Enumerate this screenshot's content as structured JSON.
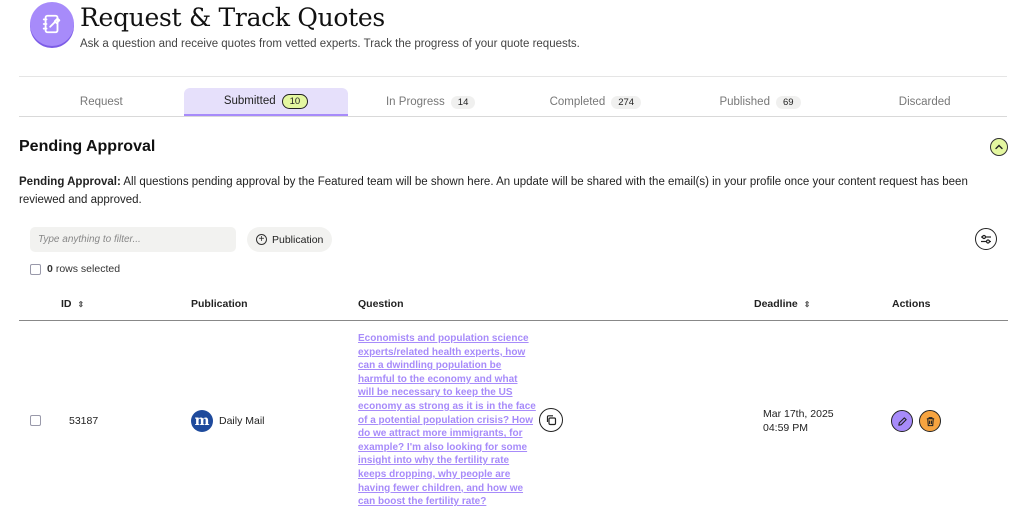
{
  "header": {
    "title": "Request & Track Quotes",
    "subtitle": "Ask a question and receive quotes from vetted experts. Track the progress of your quote requests.",
    "logo_icon": "notebook-pen-icon"
  },
  "tabs": [
    {
      "label": "Request",
      "count": null,
      "active": false
    },
    {
      "label": "Submitted",
      "count": "10",
      "active": true
    },
    {
      "label": "In Progress",
      "count": "14",
      "active": false
    },
    {
      "label": "Completed",
      "count": "274",
      "active": false
    },
    {
      "label": "Published",
      "count": "69",
      "active": false
    },
    {
      "label": "Discarded",
      "count": null,
      "active": false
    }
  ],
  "section": {
    "title": "Pending Approval",
    "info_bold": "Pending Approval:",
    "info_text": " All questions pending approval by the Featured team will be shown here. An update will be shared with the email(s) in your profile once your content request has been reviewed and approved."
  },
  "filters": {
    "placeholder": "Type anything to filter...",
    "publication_label": "Publication",
    "rows_selected_count": "0",
    "rows_selected_label": "rows selected"
  },
  "table": {
    "headers": {
      "id": "ID",
      "publication": "Publication",
      "question": "Question",
      "deadline": "Deadline",
      "actions": "Actions"
    },
    "rows": [
      {
        "id": "53187",
        "publication": "Daily Mail",
        "publication_icon_letter": "m",
        "question": "Economists and population science experts/related health experts, how can a dwindling population be harmful to the economy and what will be necessary to keep the US economy as strong as it is in the face of a potential population crisis? How do we attract more immigrants, for example? I'm also looking for some insight into why the fertility rate keeps dropping, why people are having fewer children, and how we can boost the fertility rate?",
        "deadline_date": "Mar 17th, 2025",
        "deadline_time": "04:59 PM"
      }
    ]
  },
  "colors": {
    "accent_purple": "#a78bfa",
    "tab_active_bg": "#e6e0fb",
    "badge_lime": "#e4f7a0",
    "delete_orange": "#f7a440",
    "publication_blue": "#1e4a9c"
  }
}
